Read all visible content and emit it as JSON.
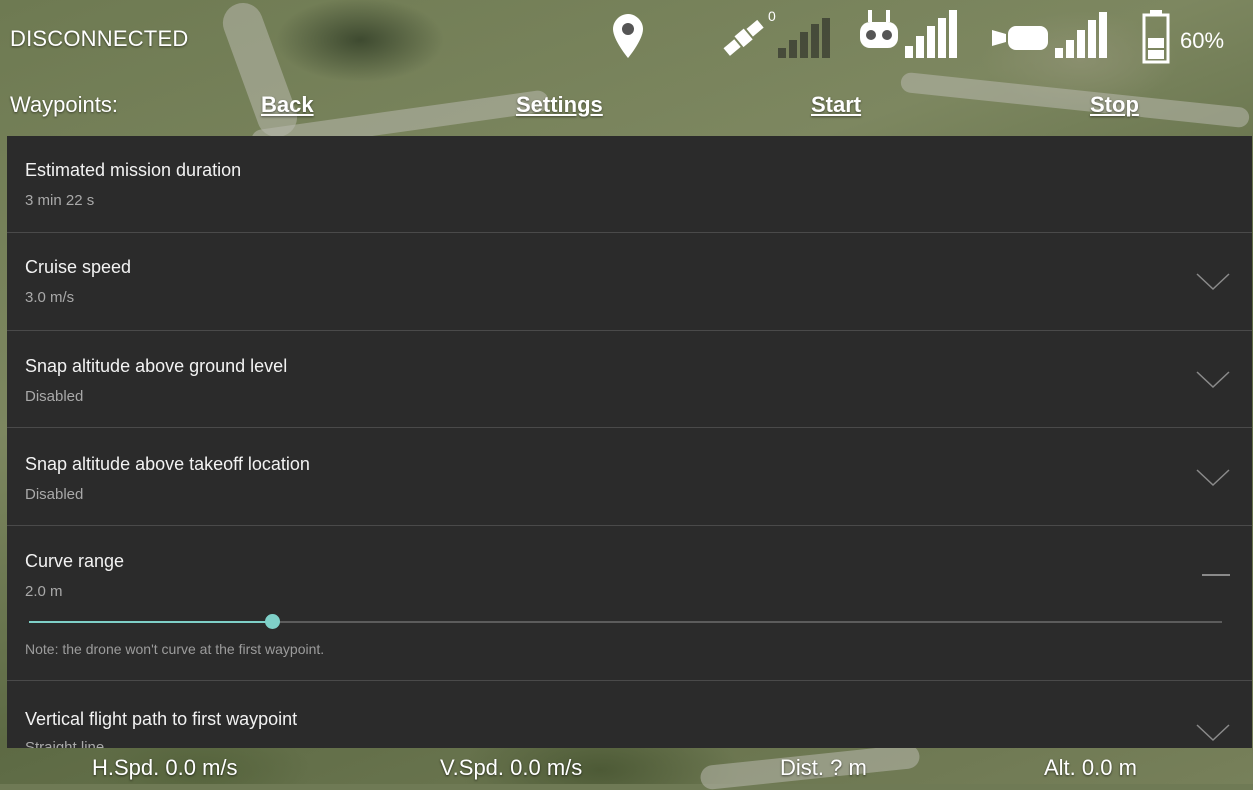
{
  "header": {
    "connection_status": "DISCONNECTED",
    "satellite_count": "0",
    "battery_percent": "60%"
  },
  "waypoints_bar": {
    "label": "Waypoints:",
    "back": "Back",
    "settings": "Settings",
    "start": "Start",
    "stop": "Stop"
  },
  "settings": {
    "duration": {
      "title": "Estimated mission duration",
      "value": "3 min 22 s"
    },
    "cruise_speed": {
      "title": "Cruise speed",
      "value": "3.0 m/s"
    },
    "snap_ground": {
      "title": "Snap altitude above ground level",
      "value": "Disabled"
    },
    "snap_takeoff": {
      "title": "Snap altitude above takeoff location",
      "value": "Disabled"
    },
    "curve_range": {
      "title": "Curve range",
      "value": "2.0 m",
      "slider_fraction": 0.204,
      "note": "Note: the drone won't curve at the first waypoint."
    },
    "vertical_path": {
      "title": "Vertical flight path to first waypoint",
      "value": "Straight line"
    }
  },
  "telemetry": {
    "h_speed": "H.Spd. 0.0 m/s",
    "v_speed": "V.Spd. 0.0 m/s",
    "distance": "Dist. ? m",
    "altitude": "Alt. 0.0 m"
  },
  "icons": {
    "location": "map-pin-icon",
    "gps": "satellite-icon",
    "remote": "remote-controller-icon",
    "video": "video-camera-icon",
    "battery": "battery-icon"
  },
  "colors": {
    "accent": "#7fd0c8",
    "panel_bg": "#2b2b2b",
    "text_primary": "#f2f2f2",
    "text_secondary": "#a9a9a9"
  }
}
